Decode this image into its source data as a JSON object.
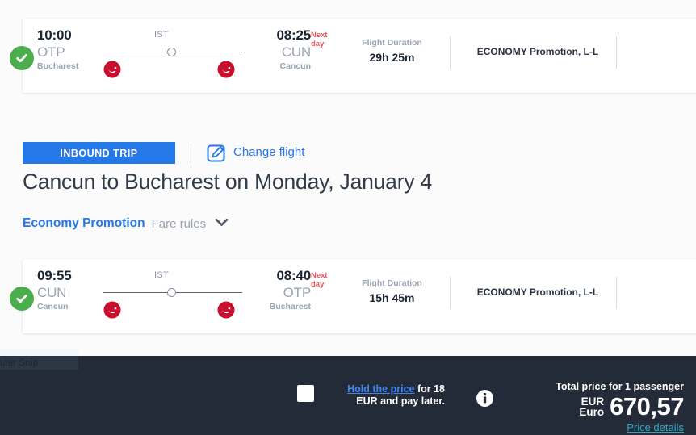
{
  "colors": {
    "accent_blue": "#2478e8",
    "link_blue": "#3e86f4",
    "bottom_bar": "#242b38",
    "price_link": "#2fa8c4",
    "check_green": "#4cad4c",
    "next_day_red": "#f0565c",
    "airline_red": "#c8102e"
  },
  "flights": [
    {
      "status_icon": "check-circle-icon",
      "depart_time": "10:00",
      "depart_code": "OTP",
      "depart_city": "Bucharest",
      "stop_label": "IST",
      "arrive_time": "08:25",
      "arrive_code": "CUN",
      "arrive_city": "Cancun",
      "next_day": "Next day",
      "duration_label": "Flight Duration",
      "duration_value": "29h 25m",
      "cabin": "ECONOMY Promotion, L-L",
      "airline_icon": "turkish-airlines-logo"
    },
    {
      "status_icon": "check-circle-icon",
      "depart_time": "09:55",
      "depart_code": "CUN",
      "depart_city": "Cancun",
      "stop_label": "IST",
      "arrive_time": "08:40",
      "arrive_code": "OTP",
      "arrive_city": "Bucharest",
      "next_day": "Next day",
      "duration_label": "Flight Duration",
      "duration_value": "15h 45m",
      "cabin": "ECONOMY Promotion, L-L",
      "airline_icon": "turkish-airlines-logo"
    }
  ],
  "inbound": {
    "tag_label": "INBOUND TRIP",
    "change_flight_label": "Change flight",
    "change_flight_icon": "pencil-edit-icon",
    "route_title": "Cancun to Bucharest on Monday, January 4",
    "fare_name": "Economy Promotion",
    "fare_rules_label": "Fare rules",
    "fare_rules_icon": "chevron-down-icon"
  },
  "snip_overlay": {
    "label": "ular Snip"
  },
  "bottom_bar": {
    "hold_link": "Hold the price",
    "hold_rest": " for 18 EUR and pay later.",
    "info_icon": "info-circle-icon",
    "checkbox_checked": false,
    "price_title": "Total price for 1 passenger",
    "currency_code": "EUR",
    "currency_name": "Euro",
    "amount": "670,57",
    "price_details_label": "Price details"
  }
}
